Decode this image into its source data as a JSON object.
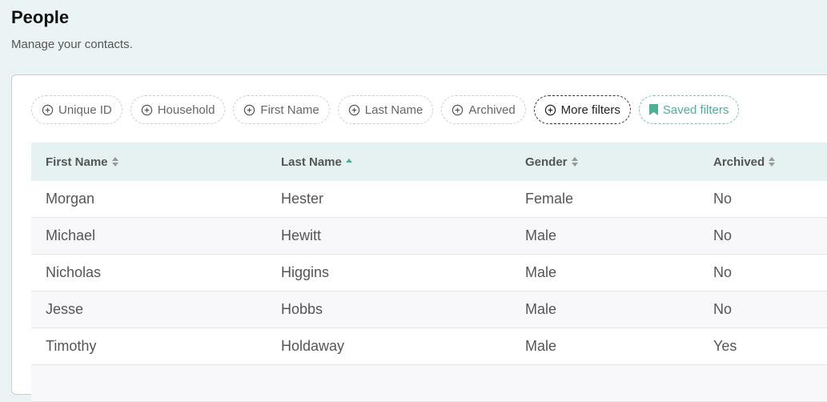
{
  "page": {
    "title": "People",
    "subtitle": "Manage your contacts."
  },
  "filters": [
    {
      "label": "Unique ID"
    },
    {
      "label": "Household"
    },
    {
      "label": "First Name"
    },
    {
      "label": "Last Name"
    },
    {
      "label": "Archived"
    }
  ],
  "more_filters_label": "More filters",
  "saved_filters_label": "Saved filters",
  "colors": {
    "accent": "#4fae98",
    "header_bg": "#e6f2f1",
    "page_bg": "#eaf4f4"
  },
  "table": {
    "columns": [
      {
        "label": "First Name",
        "sort": "none"
      },
      {
        "label": "Last Name",
        "sort": "asc"
      },
      {
        "label": "Gender",
        "sort": "none"
      },
      {
        "label": "Archived",
        "sort": "none"
      }
    ],
    "rows": [
      {
        "first": "Morgan",
        "last": "Hester",
        "gender": "Female",
        "archived": "No"
      },
      {
        "first": "Michael",
        "last": "Hewitt",
        "gender": "Male",
        "archived": "No"
      },
      {
        "first": "Nicholas",
        "last": "Higgins",
        "gender": "Male",
        "archived": "No"
      },
      {
        "first": "Jesse",
        "last": "Hobbs",
        "gender": "Male",
        "archived": "No"
      },
      {
        "first": "Timothy",
        "last": "Holdaway",
        "gender": "Male",
        "archived": "Yes"
      }
    ]
  }
}
